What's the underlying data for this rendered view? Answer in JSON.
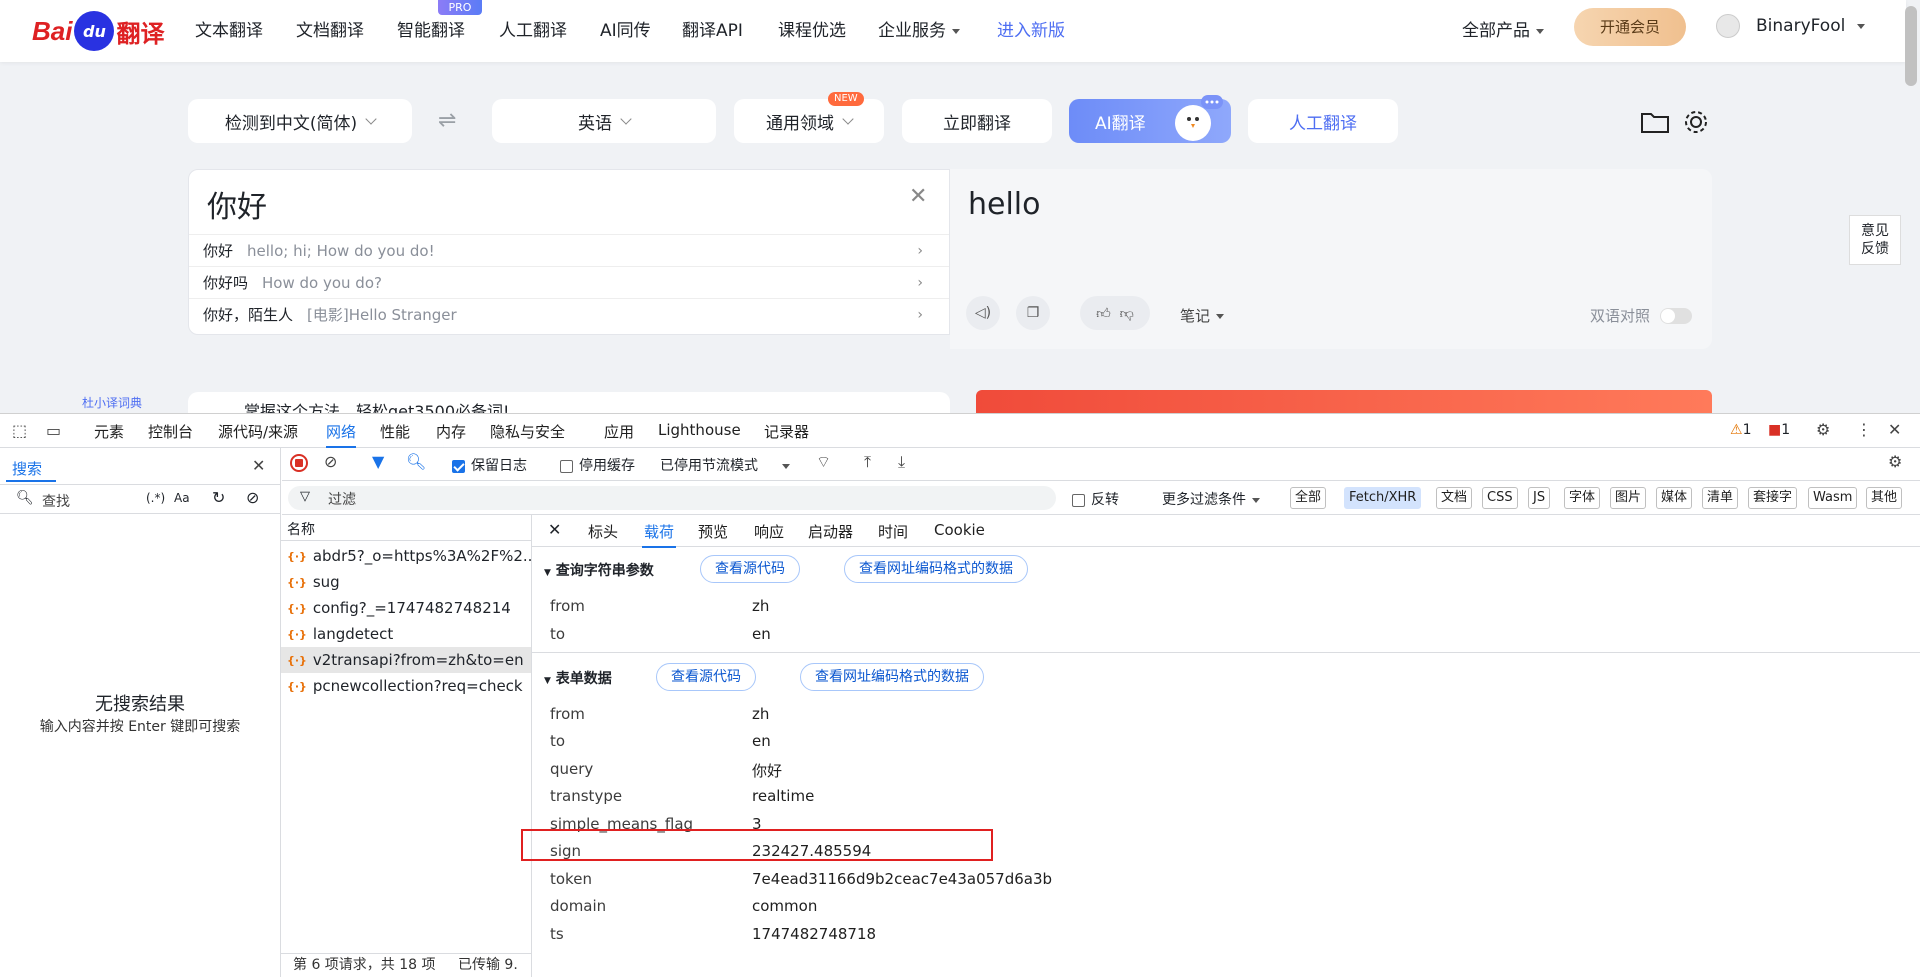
{
  "site": {
    "logo": {
      "bai": "Bai",
      "du": "du",
      "fanyi": "翻译"
    },
    "nav": [
      "文本翻译",
      "文档翻译",
      "智能翻译",
      "人工翻译",
      "AI同传",
      "翻译API",
      "课程优选",
      "企业服务",
      "进入新版"
    ],
    "pro_badge": "PRO",
    "all_products": "全部产品",
    "vip_button": "开通会员",
    "username": "BinaryFool",
    "source_lang": "检测到中文(简体)",
    "swap_glyph": "⇌",
    "target_lang": "英语",
    "domain": "通用领域",
    "new_badge": "NEW",
    "translate_now": "立即翻译",
    "ai_translate": "AI翻译",
    "human_translate": "人工翻译",
    "source_text": "你好",
    "suggestions": [
      {
        "word": "你好",
        "meaning": "hello; hi; How do you do!"
      },
      {
        "word": "你好吗",
        "meaning": "How do you do?"
      },
      {
        "word": "你好，陌生人",
        "meaning": "[电影]Hello Stranger"
      }
    ],
    "target_text": "hello",
    "notes": "笔记",
    "bilingual": "双语对照",
    "feedback": "意见\n反馈",
    "dict_label": "杜小译词典",
    "promo_text": "掌握这个方法，轻松get3500必备词!"
  },
  "devtools": {
    "tabs": [
      "元素",
      "控制台",
      "源代码/来源",
      "网络",
      "性能",
      "内存",
      "隐私与安全",
      "应用",
      "Lighthouse",
      "记录器"
    ],
    "active_tab": "网络",
    "warn_count": "1",
    "err_count": "1",
    "search_tab": "搜索",
    "search_placeholder": "查找",
    "regex_label": "(.*)",
    "case_label": "Aa",
    "no_results": "无搜索结果",
    "no_results_hint": "输入内容并按 Enter 键即可搜索",
    "preserve_log": "保留日志",
    "disable_cache": "停用缓存",
    "throttle": "已停用节流模式",
    "filter_placeholder": "过滤",
    "invert": "反转",
    "more_filters": "更多过滤条件",
    "filter_tags": [
      "全部",
      "Fetch/XHR",
      "文档",
      "CSS",
      "JS",
      "字体",
      "图片",
      "媒体",
      "清单",
      "套接字",
      "Wasm",
      "其他"
    ],
    "name_header": "名称",
    "requests": [
      "abdr5?_o=https%3A%2F%2...",
      "sug",
      "config?_=1747482748214",
      "langdetect",
      "v2transapi?from=zh&to=en",
      "pcnewcollection?req=check"
    ],
    "selected_request_index": 4,
    "detail_tabs": [
      "标头",
      "载荷",
      "预览",
      "响应",
      "启动器",
      "时间",
      "Cookie"
    ],
    "active_detail_tab": "载荷",
    "query_section": "查询字符串参数",
    "form_section": "表单数据",
    "view_source": "查看源代码",
    "view_url_encoded": "查看网址编码格式的数据",
    "query_params": [
      {
        "key": "from",
        "value": "zh"
      },
      {
        "key": "to",
        "value": "en"
      }
    ],
    "form_data": [
      {
        "key": "from",
        "value": "zh"
      },
      {
        "key": "to",
        "value": "en"
      },
      {
        "key": "query",
        "value": "你好"
      },
      {
        "key": "transtype",
        "value": "realtime"
      },
      {
        "key": "simple_means_flag",
        "value": "3"
      },
      {
        "key": "sign",
        "value": "232427.485594"
      },
      {
        "key": "token",
        "value": "7e4ead31166d9b2ceac7e43a057d6a3b"
      },
      {
        "key": "domain",
        "value": "common"
      },
      {
        "key": "ts",
        "value": "1747482748718"
      }
    ],
    "status_text": "第 6 项请求，共 18 项",
    "transfer_text": "已传输 9."
  }
}
